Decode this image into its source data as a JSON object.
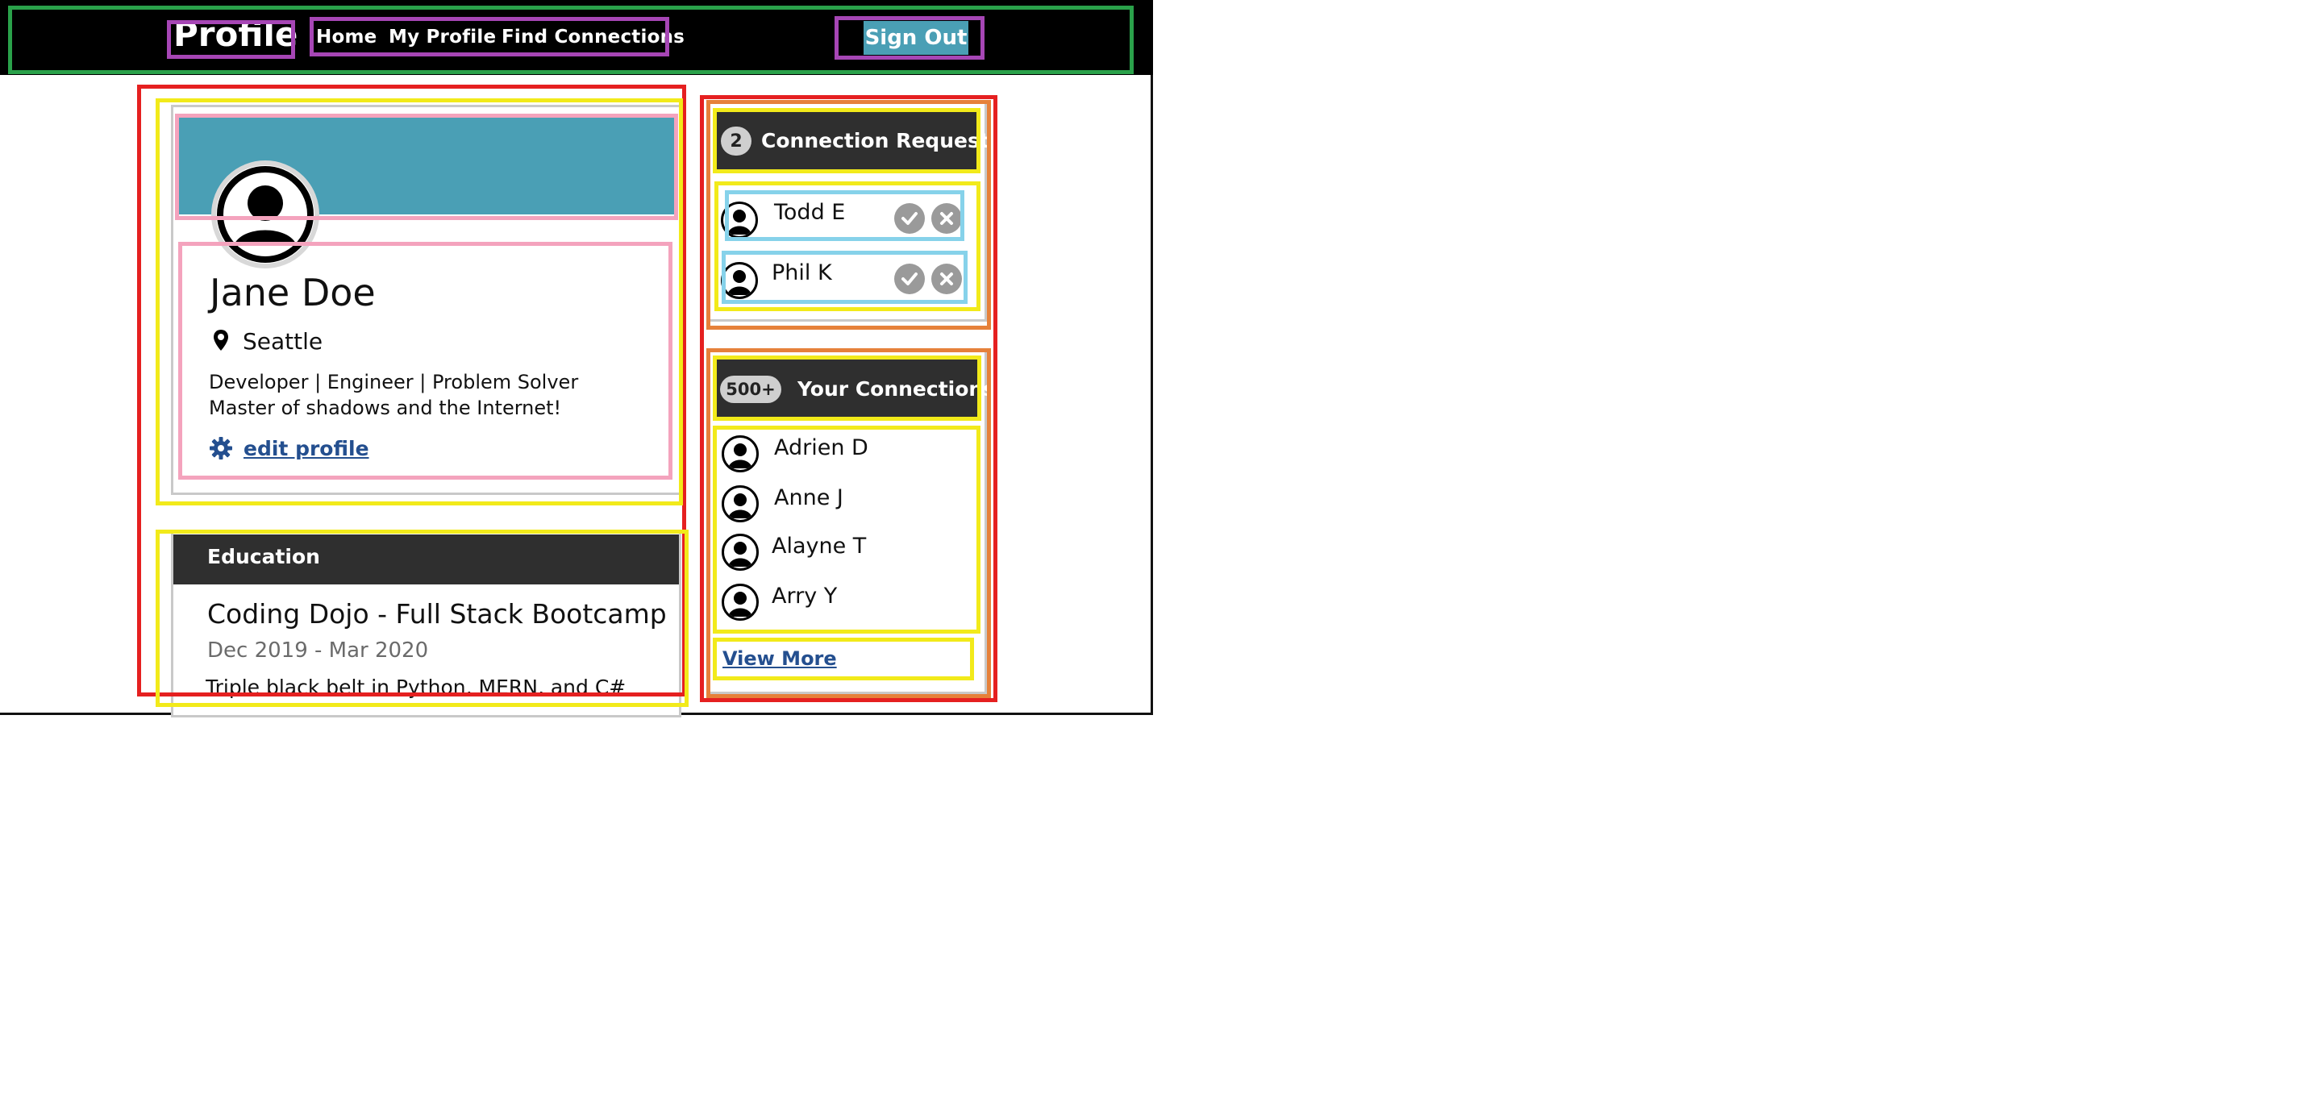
{
  "header": {
    "brand": "Profile",
    "nav": [
      {
        "label": "Home"
      },
      {
        "label": "My Profile"
      },
      {
        "label": "Find Connections"
      }
    ],
    "sign_out": "Sign Out"
  },
  "profile": {
    "name": "Jane Doe",
    "location": "Seattle",
    "bio_line1": "Developer | Engineer | Problem Solver",
    "bio_line2": "Master of shadows and the Internet!",
    "edit_link": "edit profile"
  },
  "education": {
    "heading": "Education",
    "school": "Coding Dojo - Full Stack Bootcamp",
    "dates": "Dec 2019 - Mar 2020",
    "description": "Triple black belt in Python, MERN, and C#"
  },
  "requests": {
    "count": "2",
    "heading": "Connection Requests",
    "items": [
      {
        "name": "Todd E"
      },
      {
        "name": "Phil K"
      }
    ]
  },
  "connections": {
    "count": "500+",
    "heading": "Your Connections",
    "items": [
      {
        "name": "Adrien D"
      },
      {
        "name": "Anne J"
      },
      {
        "name": "Alayne T"
      },
      {
        "name": "Arry Y"
      }
    ],
    "view_more": "View More"
  },
  "colors": {
    "banner": "#4a9fb5",
    "topbar": "#000000",
    "dark_header": "#2f2f2f",
    "link": "#244f8f"
  }
}
